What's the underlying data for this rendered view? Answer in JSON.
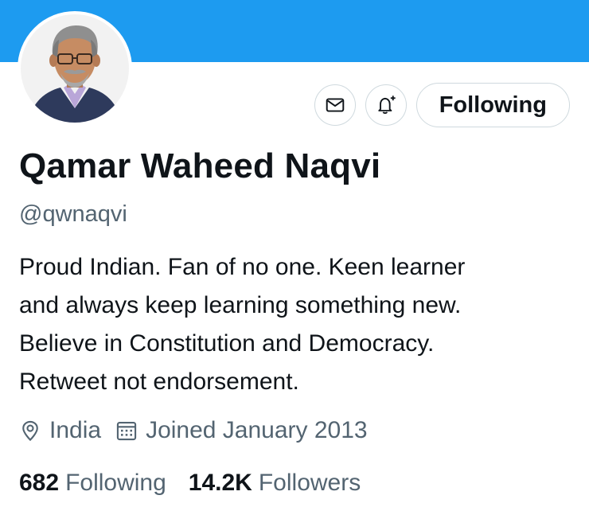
{
  "colors": {
    "banner": "#1d9bf0",
    "text_primary": "#0f1419",
    "text_secondary": "#536471",
    "border": "#cfd9de"
  },
  "profile": {
    "avatar_icon": "profile-avatar",
    "display_name": "Qamar Waheed Naqvi",
    "handle": "@qwnaqvi",
    "bio_lines": [
      "Proud Indian. Fan of no one. Keen learner",
      "and always keep learning something new.",
      "Believe in Constitution and Democracy.",
      "Retweet not endorsement."
    ],
    "location": "India",
    "joined": "Joined January 2013"
  },
  "actions": {
    "message_icon": "envelope-icon",
    "notify_icon": "bell-plus-icon",
    "follow_label": "Following"
  },
  "stats": {
    "following_count": "682",
    "following_label": "Following",
    "followers_count": "14.2K",
    "followers_label": "Followers"
  }
}
